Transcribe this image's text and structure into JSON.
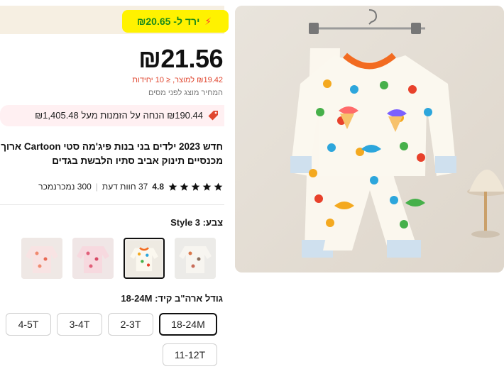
{
  "drop": {
    "text": "ירד ל- ₪20.65",
    "bolt": "⚡"
  },
  "price": {
    "main": "₪21.56",
    "bulk": "₪19.42 למוצר, ≤ 10 יחידות",
    "tax_note": "המחיר מוצג לפני מסים"
  },
  "coupon": {
    "icon": "tag-icon",
    "text": "₪190.44 הנחה על הזמנות מעל ₪1,405.48"
  },
  "product": {
    "title_line1": "חדש 2023 ילדים בני בנות פיג'מה סטי Cartoon ארוך",
    "title_line2": "מכנסיים תינוק אביב סתיו הלבשת בגדים"
  },
  "rating": {
    "value": "4.8",
    "stars": 5,
    "reviews": "37 חוות דעת",
    "sold": "300 נמכרנמכר"
  },
  "color": {
    "label": "צבע:",
    "selected": "Style 3"
  },
  "size": {
    "label": "גודל ארה\"ב קיד:",
    "selected": "18-24M",
    "options": [
      "18-24M",
      "2-3T",
      "3-4T",
      "4-5T",
      "11-12T"
    ]
  },
  "colors": {
    "accent": "#e0462f",
    "drop_green": "#1a8a1a",
    "highlight": "#fff200"
  }
}
